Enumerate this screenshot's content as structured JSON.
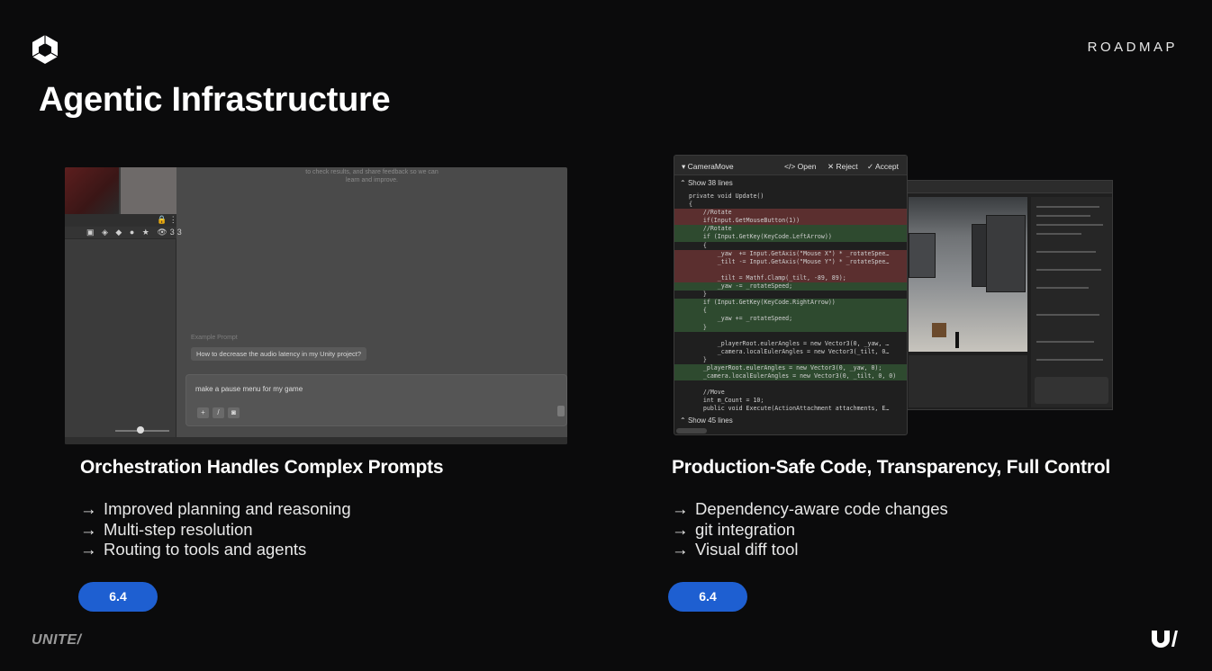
{
  "header": {
    "section_label": "ROADMAP",
    "title": "Agentic Infrastructure"
  },
  "left_column": {
    "heading": "Orchestration Handles Complex Prompts",
    "bullets": [
      "Improved planning and reasoning",
      "Multi-step resolution",
      "Routing to tools and agents"
    ],
    "version_badge": "6.4",
    "screenshot": {
      "top_text_line1": "to check results, and share feedback so we can",
      "top_text_line2": "learn and improve.",
      "example_label": "Example Prompt",
      "example_prompt": "How to decrease the audio latency in my Unity project?",
      "prompt_input_value": "make a pause menu for my game",
      "sidebar_count": "33"
    }
  },
  "right_column": {
    "heading": "Production-Safe Code, Transparency, Full Control",
    "bullets": [
      "Dependency-aware code changes",
      "git integration",
      "Visual diff tool"
    ],
    "version_badge": "6.4",
    "diff_panel": {
      "file_name": "CameraMove",
      "open_label": "</> Open",
      "reject_label": "✕ Reject",
      "accept_label": "✓ Accept",
      "show_top": "Show 38 lines",
      "show_bottom": "Show 45 lines",
      "lines": [
        {
          "type": "ctx",
          "text": "private void Update()"
        },
        {
          "type": "ctx",
          "text": "{"
        },
        {
          "type": "del",
          "text": "    //Rotate"
        },
        {
          "type": "del",
          "text": "    if(Input.GetMouseButton(1))"
        },
        {
          "type": "add",
          "text": "    //Rotate"
        },
        {
          "type": "add",
          "text": "    if (Input.GetKey(KeyCode.LeftArrow))"
        },
        {
          "type": "ctx",
          "text": "    {"
        },
        {
          "type": "del",
          "text": "        _yaw  += Input.GetAxis(\"Mouse X\") * _rotateSpee…"
        },
        {
          "type": "del",
          "text": "        _tilt -= Input.GetAxis(\"Mouse Y\") * _rotateSpee…"
        },
        {
          "type": "del",
          "text": ""
        },
        {
          "type": "del",
          "text": "        _tilt = Mathf.Clamp(_tilt, -89, 89);"
        },
        {
          "type": "add",
          "text": "        _yaw -= _rotateSpeed;"
        },
        {
          "type": "ctx",
          "text": "    }"
        },
        {
          "type": "add",
          "text": "    if (Input.GetKey(KeyCode.RightArrow))"
        },
        {
          "type": "add",
          "text": "    {"
        },
        {
          "type": "add",
          "text": "        _yaw += _rotateSpeed;"
        },
        {
          "type": "add",
          "text": "    }"
        },
        {
          "type": "ctx",
          "text": ""
        },
        {
          "type": "ctx",
          "text": "        _playerRoot.eulerAngles = new Vector3(0, _yaw, …"
        },
        {
          "type": "ctx",
          "text": "        _camera.localEulerAngles = new Vector3(_tilt, 0…"
        },
        {
          "type": "ctx",
          "text": "    }"
        },
        {
          "type": "add",
          "text": "    _playerRoot.eulerAngles = new Vector3(0, _yaw, 0);"
        },
        {
          "type": "add",
          "text": "    _camera.localEulerAngles = new Vector3(0, _tilt, 0, 0)"
        },
        {
          "type": "ctx",
          "text": ""
        },
        {
          "type": "ctx",
          "text": "    //Move"
        },
        {
          "type": "ctx",
          "text": "    int m_Count = 10;"
        },
        {
          "type": "ctx",
          "text": "    public void Execute(ActionAttachment attachments, E…"
        }
      ]
    }
  },
  "footer": {
    "brand_text": "UNITE/"
  }
}
